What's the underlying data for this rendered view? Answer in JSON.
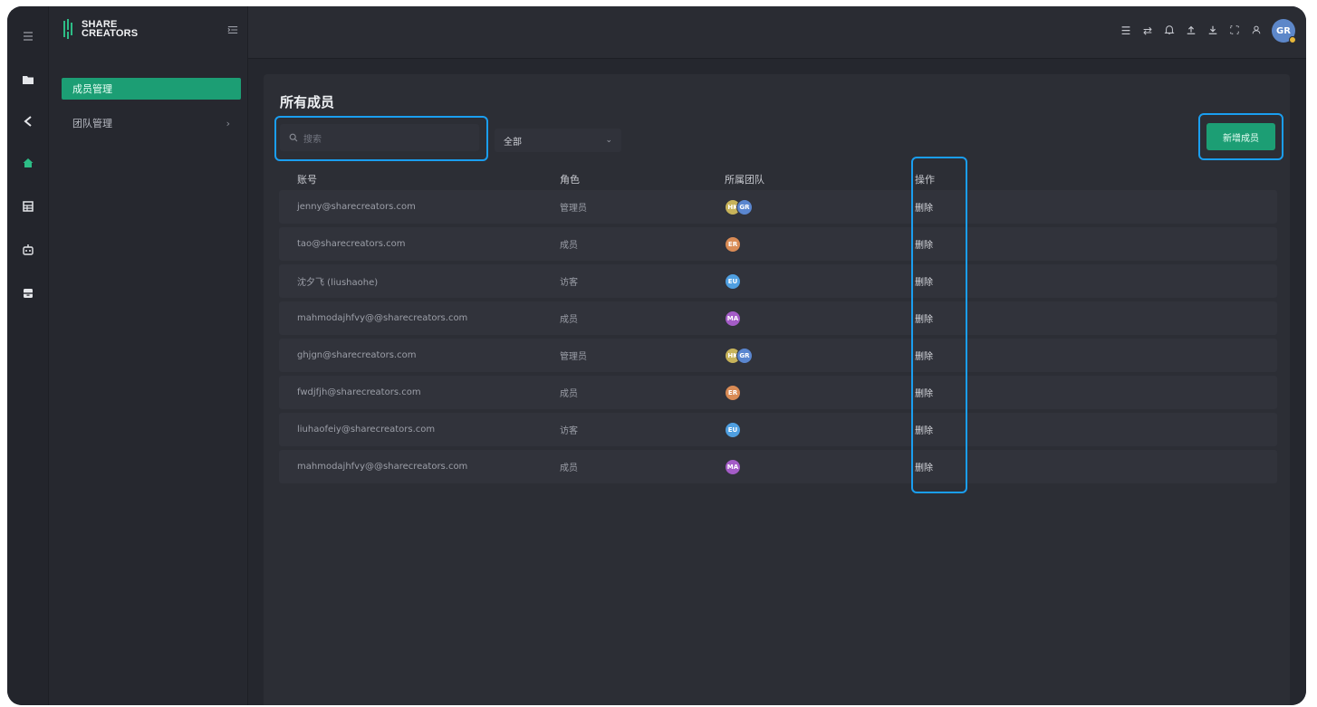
{
  "app": {
    "logo_line1": "SHARE",
    "logo_line2": "CREATORS"
  },
  "rail": {
    "icons": [
      "menu-icon",
      "folder-icon",
      "share-icon",
      "home-icon",
      "table-icon",
      "robot-icon",
      "archive-icon"
    ]
  },
  "sidebar": {
    "items": [
      {
        "label": "成员管理",
        "active": true
      },
      {
        "label": "团队管理",
        "active": false,
        "has_children": true
      }
    ]
  },
  "topbar": {
    "icons": [
      "list-icon",
      "swap-icon",
      "bell-icon",
      "upload-icon",
      "download-icon",
      "fullscreen-icon",
      "user-icon"
    ],
    "avatar_initials": "GR"
  },
  "page": {
    "title": "所有成员",
    "search_placeholder": "搜索",
    "filter_value": "全部",
    "add_button": "新增成员"
  },
  "table": {
    "headers": {
      "account": "账号",
      "role": "角色",
      "team": "所属团队",
      "op": "操作"
    },
    "rows": [
      {
        "account": "jenny@sharecreators.com",
        "role": "管理员",
        "teams": [
          {
            "t": "HK",
            "c": "#c7b35a"
          },
          {
            "t": "GR",
            "c": "#5a86cf"
          }
        ],
        "op": "删除"
      },
      {
        "account": "tao@sharecreators.com",
        "role": "成员",
        "teams": [
          {
            "t": "ER",
            "c": "#d98b55"
          }
        ],
        "op": "删除"
      },
      {
        "account": "沈夕飞 (liushaohe)",
        "role": "访客",
        "teams": [
          {
            "t": "EU",
            "c": "#4f9fe0"
          }
        ],
        "op": "删除"
      },
      {
        "account": "mahmodajhfvy@@sharecreators.com",
        "role": "成员",
        "teams": [
          {
            "t": "MA",
            "c": "#a45cc7"
          }
        ],
        "op": "删除"
      },
      {
        "account": "ghjgn@sharecreators.com",
        "role": "管理员",
        "teams": [
          {
            "t": "HK",
            "c": "#c7b35a"
          },
          {
            "t": "GR",
            "c": "#5a86cf"
          }
        ],
        "op": "删除"
      },
      {
        "account": "fwdjfjh@sharecreators.com",
        "role": "成员",
        "teams": [
          {
            "t": "ER",
            "c": "#d98b55"
          }
        ],
        "op": "删除"
      },
      {
        "account": "liuhaofeiy@sharecreators.com",
        "role": "访客",
        "teams": [
          {
            "t": "EU",
            "c": "#4f9fe0"
          }
        ],
        "op": "删除"
      },
      {
        "account": "mahmodajhfvy@@sharecreators.com",
        "role": "成员",
        "teams": [
          {
            "t": "MA",
            "c": "#a45cc7"
          }
        ],
        "op": "删除"
      }
    ]
  },
  "colors": {
    "accent": "#1c9e74",
    "highlight": "#1a9ef0"
  }
}
